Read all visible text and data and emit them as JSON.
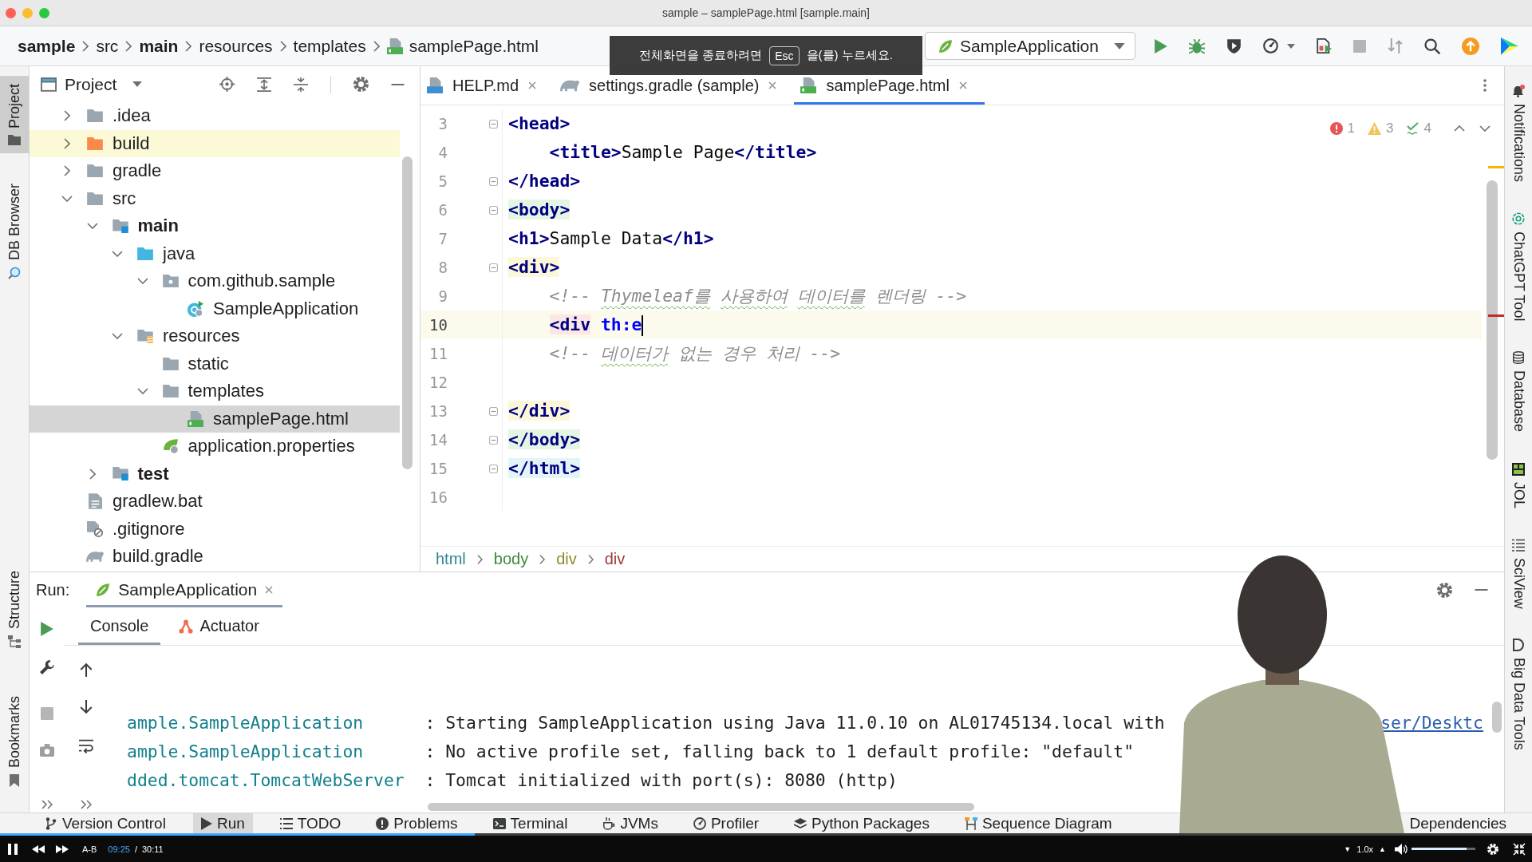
{
  "window": {
    "title": "sample – samplePage.html [sample.main]"
  },
  "navigation_bar": {
    "breadcrumbs": [
      {
        "label": "sample",
        "kind": "project"
      },
      {
        "label": "src",
        "kind": "folder"
      },
      {
        "label": "main",
        "kind": "module"
      },
      {
        "label": "resources",
        "kind": "folder"
      },
      {
        "label": "templates",
        "kind": "folder"
      },
      {
        "label": "samplePage.html",
        "kind": "html-file"
      }
    ],
    "run_configuration": {
      "label": "SampleApplication"
    }
  },
  "fullscreen_notice": {
    "before_key": "전체화면을 종료하려면",
    "key": "Esc",
    "after_key": "을(를) 누르세요."
  },
  "left_tool_stripe": [
    {
      "label": "Project",
      "selected": true
    },
    {
      "label": "DB Browser",
      "selected": false
    },
    {
      "label": "Structure",
      "selected": false
    },
    {
      "label": "Bookmarks",
      "selected": false
    }
  ],
  "project_panel": {
    "title": "Project",
    "tree": [
      {
        "label": ".idea",
        "kind": "folder",
        "expanded": false,
        "selected": false,
        "highlighted": false
      },
      {
        "label": "build",
        "kind": "excluded-folder",
        "expanded": false,
        "selected": false,
        "highlighted": true
      },
      {
        "label": "gradle",
        "kind": "folder",
        "expanded": false,
        "selected": false,
        "highlighted": false
      },
      {
        "label": "src",
        "kind": "folder",
        "expanded": true,
        "selected": false,
        "highlighted": false,
        "children": [
          {
            "label": "main",
            "kind": "module-folder",
            "expanded": true,
            "selected": false,
            "highlighted": false,
            "children": [
              {
                "label": "java",
                "kind": "source-folder",
                "expanded": true,
                "selected": false,
                "highlighted": false,
                "children": [
                  {
                    "label": "com.github.sample",
                    "kind": "package",
                    "expanded": true,
                    "selected": false,
                    "highlighted": false,
                    "children": [
                      {
                        "label": "SampleApplication",
                        "kind": "spring-class",
                        "selected": false,
                        "highlighted": false
                      }
                    ]
                  }
                ]
              },
              {
                "label": "resources",
                "kind": "resources-folder",
                "expanded": true,
                "selected": false,
                "highlighted": false,
                "children": [
                  {
                    "label": "static",
                    "kind": "folder",
                    "selected": false,
                    "highlighted": false
                  },
                  {
                    "label": "templates",
                    "kind": "folder",
                    "expanded": true,
                    "selected": false,
                    "highlighted": false,
                    "children": [
                      {
                        "label": "samplePage.html",
                        "kind": "html-file",
                        "selected": true,
                        "highlighted": false
                      }
                    ]
                  },
                  {
                    "label": "application.properties",
                    "kind": "spring-properties",
                    "selected": false,
                    "highlighted": false
                  }
                ]
              }
            ]
          },
          {
            "label": "test",
            "kind": "module-folder",
            "expanded": false,
            "selected": false,
            "highlighted": false
          }
        ]
      },
      {
        "label": "gradlew.bat",
        "kind": "text-file",
        "selected": false,
        "highlighted": false
      },
      {
        "label": ".gitignore",
        "kind": "ignore-file",
        "selected": false,
        "highlighted": false
      },
      {
        "label": "build.gradle",
        "kind": "gradle-file",
        "selected": false,
        "highlighted": false
      }
    ]
  },
  "editor": {
    "tabs": [
      {
        "label": "HELP.md",
        "kind": "markdown",
        "selected": false
      },
      {
        "label": "settings.gradle (sample)",
        "kind": "gradle",
        "selected": false
      },
      {
        "label": "samplePage.html",
        "kind": "html",
        "selected": true
      }
    ],
    "inspections": {
      "errors": "1",
      "warnings": "3",
      "weak_warnings": "4"
    },
    "lines": [
      {
        "number": "3",
        "current": false,
        "fold_marker": true,
        "tokens": [
          {
            "kind": "tag",
            "text": "<head>"
          }
        ]
      },
      {
        "number": "4",
        "current": false,
        "fold_marker": false,
        "tokens": [
          {
            "kind": "tag",
            "text": "    <title>"
          },
          {
            "kind": "text",
            "text": "Sample Page"
          },
          {
            "kind": "tag",
            "text": "</title>"
          }
        ]
      },
      {
        "number": "5",
        "current": false,
        "fold_marker": true,
        "tokens": [
          {
            "kind": "tag",
            "text": "</head>"
          }
        ]
      },
      {
        "number": "6",
        "current": false,
        "fold_marker": true,
        "tokens": [
          {
            "kind": "tag",
            "text": "<body>",
            "color": "#e4f5e4"
          }
        ]
      },
      {
        "number": "7",
        "current": false,
        "fold_marker": false,
        "tokens": [
          {
            "kind": "tag",
            "text": "<h1>"
          },
          {
            "kind": "text",
            "text": "Sample Data"
          },
          {
            "kind": "tag",
            "text": "</h1>"
          }
        ]
      },
      {
        "number": "8",
        "current": false,
        "fold_marker": true,
        "tokens": [
          {
            "kind": "tag",
            "text": "<div>",
            "color": "#fbf7d8"
          }
        ]
      },
      {
        "number": "9",
        "current": false,
        "fold_marker": false,
        "tokens": [
          {
            "kind": "comment",
            "text": "    <!-- ",
            "typo": false
          },
          {
            "kind": "comment",
            "text": "Thymeleaf를",
            "typo": true
          },
          {
            "kind": "comment",
            "text": " 사용하여",
            "typo": true
          },
          {
            "kind": "comment",
            "text": " 데이터를",
            "typo": true
          },
          {
            "kind": "comment",
            "text": " 렌더링 -->",
            "typo": false
          }
        ]
      },
      {
        "number": "10",
        "current": true,
        "fold_marker": false,
        "tokens": [
          {
            "kind": "tag",
            "text": "    <div",
            "color": "#fce6e6"
          },
          {
            "kind": "attr",
            "text": " th:e"
          }
        ]
      },
      {
        "number": "11",
        "current": false,
        "fold_marker": false,
        "tokens": [
          {
            "kind": "comment",
            "text": "    <!-- ",
            "typo": false
          },
          {
            "kind": "comment",
            "text": "데이터가",
            "typo": true
          },
          {
            "kind": "comment",
            "text": " 없는 경우 처리 -->",
            "typo": false
          }
        ]
      },
      {
        "number": "12",
        "current": false,
        "fold_marker": false
      },
      {
        "number": "13",
        "current": false,
        "fold_marker": true,
        "tokens": [
          {
            "kind": "tag",
            "text": "</div>",
            "color": "#fbf7d8"
          }
        ]
      },
      {
        "number": "14",
        "current": false,
        "fold_marker": true,
        "tokens": [
          {
            "kind": "tag",
            "text": "</body>",
            "color": "#e4f5e4"
          }
        ]
      },
      {
        "number": "15",
        "current": false,
        "fold_marker": true,
        "tokens": [
          {
            "kind": "tag",
            "text": "</html>",
            "color": "#e2f5f8"
          }
        ]
      },
      {
        "number": "16",
        "current": false,
        "fold_marker": false
      }
    ],
    "breadcrumbs": [
      {
        "label": "html",
        "color": "#2f8790"
      },
      {
        "label": "body",
        "color": "#3b8a3b"
      },
      {
        "label": "div",
        "color": "#8c8a2a"
      },
      {
        "label": "div",
        "color": "#a03a3a"
      }
    ]
  },
  "run_panel": {
    "title": "Run:",
    "tabs": [
      {
        "label": "SampleApplication",
        "selected": true
      }
    ],
    "subtabs": [
      {
        "label": "Console",
        "selected": true
      },
      {
        "label": "Actuator",
        "selected": false
      }
    ],
    "console_lines": [
      {
        "logger": "ample.SampleApplication",
        "message": ": Starting SampleApplication using Java 11.0.10 on AL01745134.local with",
        "link": "ser/Desktc"
      },
      {
        "logger": "ample.SampleApplication",
        "message": ": No active profile set, falling back to 1 default profile: \"default\""
      },
      {
        "logger": "dded.tomcat.TomcatWebServer",
        "message": ": Tomcat initialized with port(s): 8080 (http)"
      }
    ]
  },
  "right_tool_stripe": [
    {
      "label": "Notifications",
      "selected": false
    },
    {
      "label": "ChatGPT Tool",
      "selected": false
    },
    {
      "label": "Database",
      "selected": false
    },
    {
      "label": "JOL",
      "selected": false
    },
    {
      "label": "SciView",
      "selected": false
    },
    {
      "label": "Big Data Tools",
      "selected": false
    }
  ],
  "bottom_tool_bar": {
    "left": [
      {
        "label": "Version Control",
        "selected": false
      },
      {
        "label": "Run",
        "selected": true
      },
      {
        "label": "TODO",
        "selected": false
      },
      {
        "label": "Problems",
        "selected": false
      },
      {
        "label": "Terminal",
        "selected": false
      },
      {
        "label": "JVMs",
        "selected": false
      },
      {
        "label": "Profiler",
        "selected": false
      },
      {
        "label": "Python Packages",
        "selected": false
      },
      {
        "label": "Sequence Diagram",
        "selected": false
      }
    ],
    "right": [
      {
        "label": "Dependencies",
        "selected": false
      }
    ]
  },
  "video_player": {
    "ab_repeat": "A-B",
    "elapsed": "09:25",
    "separator": "/",
    "duration": "30:11",
    "speed_down": "▼",
    "speed": "1.0x",
    "speed_up": "▲",
    "progress": {
      "level": 0.31
    },
    "volume": {
      "level": 0.86
    }
  },
  "presenter_video": {
    "visible": true
  }
}
